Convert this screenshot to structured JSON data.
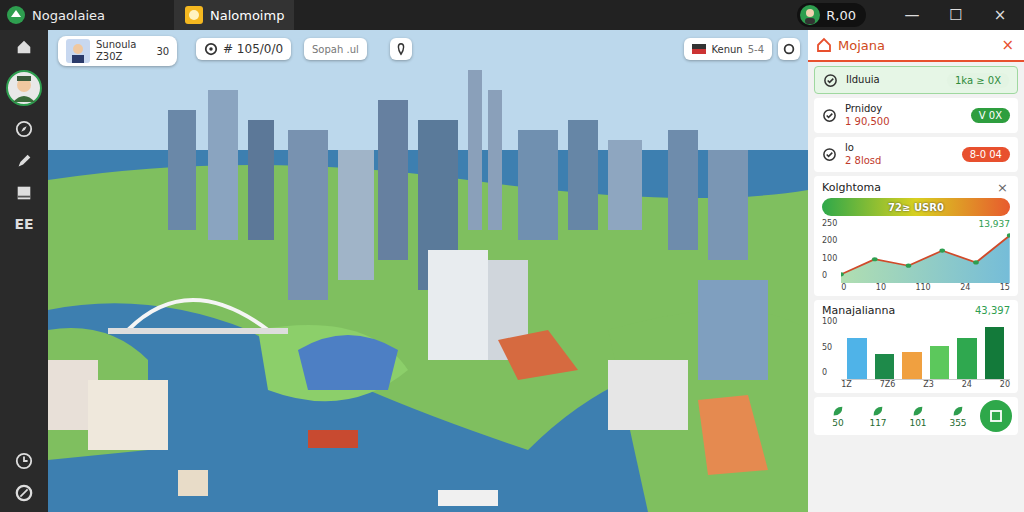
{
  "window": {
    "title": "Nogaolaiea",
    "balance": "R,00",
    "controls": [
      "—",
      "☐",
      "×"
    ]
  },
  "tabs": [
    {
      "label": "Nalomoimp",
      "selected": true
    }
  ],
  "sidebar": {
    "label": "EE"
  },
  "player_card": {
    "name": "Sunoula",
    "sub": "Z30Z",
    "value": "30"
  },
  "toolbar": {
    "counter": "# 105/0/0",
    "search": "Sopah .ul",
    "region": "Kenun",
    "region_value": "5-4"
  },
  "panel": {
    "title": "Mojana",
    "close": "×",
    "rows": [
      {
        "name": "Ilduuia",
        "sub": "",
        "badge": "1ka ≥ 0X",
        "color": "#e3f4e3",
        "text_color": "#2e8b3a"
      },
      {
        "name": "Prnidoy",
        "sub": "1 90,500",
        "badge": "V 0X",
        "color": "#2e9e3f",
        "text_color": "#ffffff"
      },
      {
        "name": "lo",
        "sub": "2 8losd",
        "badge": "8-0 04",
        "color": "#e8502e",
        "text_color": "#ffffff"
      }
    ]
  },
  "line_chart": {
    "title": "Kolghtoma",
    "close": "×",
    "scale_label": "72≥ USR0",
    "value": "13,937",
    "y_ticks": [
      "250",
      "200",
      "100",
      "0"
    ],
    "x_ticks": [
      "0",
      "10",
      "110",
      "24",
      "15"
    ],
    "max": 250,
    "series": [
      40,
      110,
      80,
      150,
      95,
      220
    ]
  },
  "bar_chart": {
    "title": "Manajalianna",
    "value": "43,397",
    "y_ticks": [
      "100",
      "50",
      "0"
    ],
    "x_ticks": [
      "1Z",
      "7Z6",
      "Z3",
      "24",
      "20"
    ],
    "max": 150,
    "values": [
      100,
      60,
      65,
      80,
      100,
      125
    ],
    "colors": [
      "#4fb3e8",
      "#1e8a4a",
      "#f0a040",
      "#5cc85c",
      "#2fa84f",
      "#137a3a"
    ]
  },
  "stats": [
    "50",
    "117",
    "101",
    "355"
  ]
}
